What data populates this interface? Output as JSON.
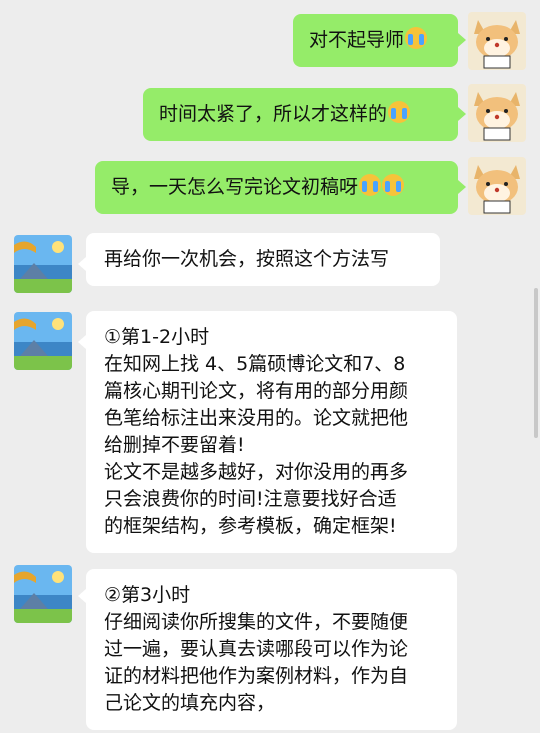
{
  "messages": [
    {
      "side": "right",
      "text": "对不起导师",
      "emoji": [
        "cry-emoji"
      ]
    },
    {
      "side": "right",
      "text": "时间太紧了，所以才这样的",
      "emoji": [
        "cry-emoji"
      ]
    },
    {
      "side": "right",
      "text": "导，一天怎么写完论文初稿呀",
      "emoji": [
        "cry-emoji",
        "cry-emoji"
      ]
    },
    {
      "side": "left",
      "lines": [
        "再给你一次机会，按照这个方法写"
      ]
    },
    {
      "side": "left",
      "lines": [
        "①第1-2小时",
        "在知网上找 4、5篇硕博论文和7、8",
        "篇核心期刊论文，将有用的部分用颜",
        "色笔给标注出来没用的。论文就把他",
        "给删掉不要留着!",
        "论文不是越多越好，对你没用的再多",
        "只会浪费你的时间!注意要找好合适",
        "的框架结构，参考模板，确定框架!"
      ]
    },
    {
      "side": "left",
      "lines": [
        "②第3小时",
        "仔细阅读你所搜集的文件，不要随便",
        "过一遍，要认真去读哪段可以作为论",
        "证的材料把他作为案例材料，作为自",
        "己论文的填充内容，"
      ]
    }
  ],
  "colors": {
    "background": "#ededed",
    "my_bubble": "#95ec69",
    "their_bubble": "#ffffff"
  }
}
